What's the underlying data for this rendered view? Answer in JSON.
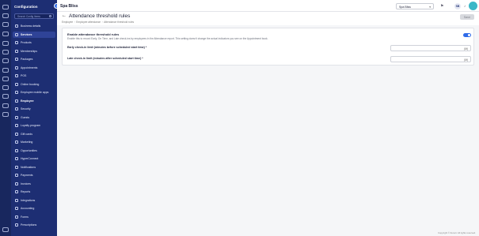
{
  "sidebar": {
    "title": "Configuration",
    "search_placeholder": "Search Config Items",
    "items": [
      {
        "label": "Business details",
        "section": false
      },
      {
        "label": "Services",
        "section": false,
        "active": true
      },
      {
        "label": "Products",
        "section": false
      },
      {
        "label": "Memberships",
        "section": false
      },
      {
        "label": "Packages",
        "section": false
      },
      {
        "label": "Appointments",
        "section": false
      },
      {
        "label": "POS",
        "section": false
      },
      {
        "label": "Online booking",
        "section": false
      },
      {
        "label": "Employee mobile apps",
        "section": false
      },
      {
        "label": "Employee",
        "section": true
      },
      {
        "label": "Security",
        "section": false
      },
      {
        "label": "Guests",
        "section": false
      },
      {
        "label": "Loyalty program",
        "section": false
      },
      {
        "label": "Gift cards",
        "section": false
      },
      {
        "label": "Marketing",
        "section": false
      },
      {
        "label": "Opportunities",
        "section": false
      },
      {
        "label": "HyperConnect",
        "section": false
      },
      {
        "label": "Notifications",
        "section": false
      },
      {
        "label": "Payments",
        "section": false
      },
      {
        "label": "Invoices",
        "section": false
      },
      {
        "label": "Reports",
        "section": false
      },
      {
        "label": "Integrations",
        "section": false
      },
      {
        "label": "Accounting",
        "section": false
      },
      {
        "label": "Forms",
        "section": false
      },
      {
        "label": "Prescriptions",
        "section": false
      }
    ]
  },
  "topbar": {
    "brand": "Spa Bliss",
    "location": "Spa Bliss",
    "avatar_initials": "SB"
  },
  "page": {
    "title": "Attendance threshold rules",
    "breadcrumbs": [
      "Employee",
      "Employee attendance",
      "Attendance threshold rules"
    ],
    "save_label": "Save"
  },
  "settings": {
    "enable_label": "Enable attendance threshold rules",
    "enable_description": "Enable this to record Early, On Time, and Late check-ins by employees in the Attendance report. This setting doesn't change the actual indicators you see on the Appointment book.",
    "enable_on": true,
    "early_label": "Early check-in limit (minutes before scheduled start time) *",
    "early_value": "",
    "early_unit": "(M)",
    "late_label": "Late check-in limit (minutes after scheduled start time) *",
    "late_value": "",
    "late_unit": "(M)"
  },
  "footer": "Copyright © Zenoti. All rights reserved."
}
